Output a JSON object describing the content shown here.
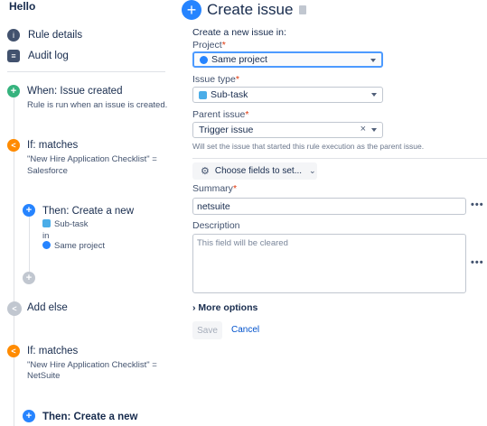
{
  "app_title": "Hello",
  "nav": {
    "rule_details": "Rule details",
    "audit_log": "Audit log"
  },
  "flow": {
    "when_title": "When: Issue created",
    "when_sub": "Rule is run when an issue is created.",
    "if1_title": "If: matches",
    "if1_sub_line1": "\"New Hire Application Checklist\" =",
    "if1_sub_line2": "Salesforce",
    "then1_title": "Then: Create a new",
    "then1_type": "Sub-task",
    "then1_in": "in",
    "then1_project": "Same project",
    "add_else": "Add else",
    "if2_title": "If: matches",
    "if2_sub_line1": "\"New Hire Application Checklist\" =",
    "if2_sub_line2": "NetSuite",
    "then2_title": "Then: Create a new"
  },
  "form": {
    "title": "Create issue",
    "create_in_label": "Create a new issue in:",
    "project_label": "Project",
    "project_value": "Same project",
    "issue_type_label": "Issue type",
    "issue_type_value": "Sub-task",
    "parent_label": "Parent issue",
    "parent_value": "Trigger issue",
    "parent_helper": "Will set the issue that started this rule execution as the parent issue.",
    "choose_fields": "Choose fields to set...",
    "summary_label": "Summary",
    "summary_value": "netsuite",
    "description_label": "Description",
    "description_placeholder": "This field will be cleared",
    "more_options": "More options",
    "save": "Save",
    "cancel": "Cancel",
    "required_mark": "*",
    "dots": "•••"
  },
  "colors": {
    "accent": "#2684ff",
    "trigger": "#36b37e",
    "condition": "#ff8b00",
    "link": "#0052cc"
  }
}
